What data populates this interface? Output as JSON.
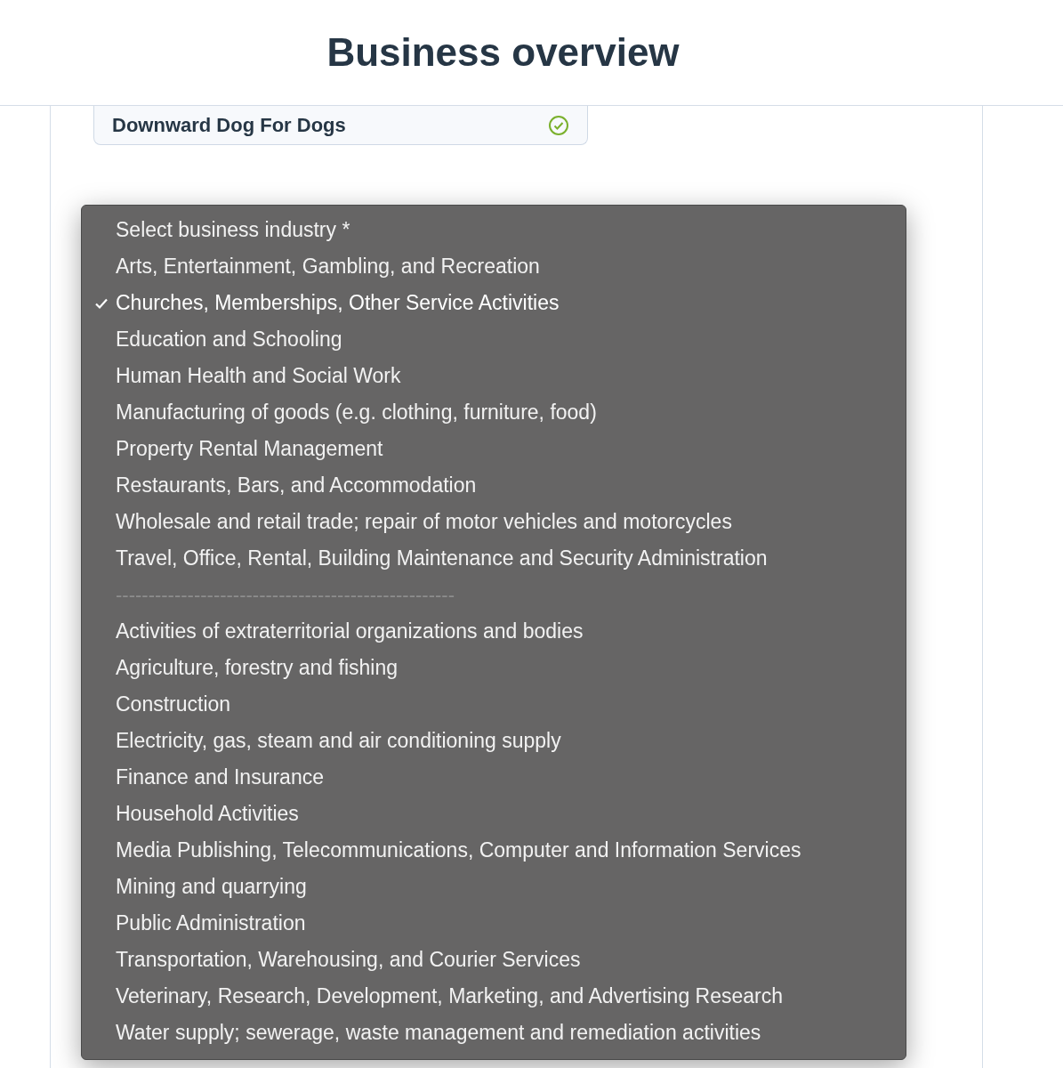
{
  "header": {
    "title": "Business overview"
  },
  "business_name": {
    "value": "Downward Dog For Dogs",
    "valid": true
  },
  "industry_menu": {
    "options": [
      {
        "kind": "option",
        "label": "Select business industry *",
        "selected": false
      },
      {
        "kind": "option",
        "label": "Arts, Entertainment, Gambling, and Recreation",
        "selected": false
      },
      {
        "kind": "option",
        "label": "Churches, Memberships, Other Service Activities",
        "selected": true
      },
      {
        "kind": "option",
        "label": "Education and Schooling",
        "selected": false
      },
      {
        "kind": "option",
        "label": "Human Health and Social Work",
        "selected": false
      },
      {
        "kind": "option",
        "label": "Manufacturing of goods (e.g. clothing, furniture, food)",
        "selected": false
      },
      {
        "kind": "option",
        "label": "Property Rental Management",
        "selected": false
      },
      {
        "kind": "option",
        "label": "Restaurants, Bars, and Accommodation",
        "selected": false
      },
      {
        "kind": "option",
        "label": "Wholesale and retail trade; repair of motor vehicles and motorcycles",
        "selected": false
      },
      {
        "kind": "option",
        "label": "Travel, Office, Rental, Building Maintenance and Security Administration",
        "selected": false
      },
      {
        "kind": "separator",
        "label": "----------------------------------------------------"
      },
      {
        "kind": "option",
        "label": "Activities of extraterritorial organizations and bodies",
        "selected": false
      },
      {
        "kind": "option",
        "label": "Agriculture, forestry and fishing",
        "selected": false
      },
      {
        "kind": "option",
        "label": "Construction",
        "selected": false
      },
      {
        "kind": "option",
        "label": "Electricity, gas, steam and air conditioning supply",
        "selected": false
      },
      {
        "kind": "option",
        "label": "Finance and Insurance",
        "selected": false
      },
      {
        "kind": "option",
        "label": "Household Activities",
        "selected": false
      },
      {
        "kind": "option",
        "label": "Media Publishing, Telecommunications, Computer and Information Services",
        "selected": false
      },
      {
        "kind": "option",
        "label": "Mining and quarrying",
        "selected": false
      },
      {
        "kind": "option",
        "label": "Public Administration",
        "selected": false
      },
      {
        "kind": "option",
        "label": "Transportation, Warehousing, and Courier Services",
        "selected": false
      },
      {
        "kind": "option",
        "label": "Veterinary, Research, Development, Marketing, and Advertising Research",
        "selected": false
      },
      {
        "kind": "option",
        "label": "Water supply; sewerage, waste management and remediation activities",
        "selected": false
      }
    ]
  }
}
